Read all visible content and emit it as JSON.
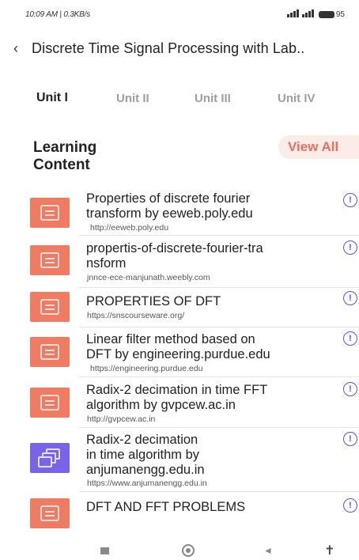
{
  "status_bar": {
    "left_text": "10:09 AM | 0.3KB/s",
    "right_icons": [
      "signal-icon",
      "wifi-icon",
      "battery-icon"
    ],
    "battery_level": "95"
  },
  "header": {
    "back_icon": "‹",
    "title": "Discrete Time Signal Processing with Lab.."
  },
  "tabs": [
    {
      "label": "Unit I",
      "active": true
    },
    {
      "label": "Unit II",
      "active": false
    },
    {
      "label": "Unit III",
      "active": false
    },
    {
      "label": "Unit IV",
      "active": false
    }
  ],
  "section": {
    "title_line1": "Learning",
    "title_line2": "Content",
    "view_all": "View All"
  },
  "items": [
    {
      "title_lines": [
        "Properties of discrete fourier",
        "transform by eeweb.poly.edu"
      ],
      "url": "http://eeweb.poly.edu",
      "icon": "document-icon",
      "color": "#ef7b63"
    },
    {
      "title_lines": [
        "propertis-of-discrete-fourier-tra",
        "nsform"
      ],
      "url": "jnnce-ece-manjunath.weebly.com",
      "icon": "document-icon",
      "color": "#ef7b63"
    },
    {
      "title_lines": [
        "PROPERTIES OF DFT"
      ],
      "url": "https://snscourseware.org/",
      "icon": "document-icon",
      "color": "#ef7b63"
    },
    {
      "title_lines": [
        "Linear filter method based on",
        "DFT by engineering.purdue.edu"
      ],
      "url": "https://engineering.purdue.edu",
      "icon": "document-icon",
      "color": "#ef7b63"
    },
    {
      "title_lines": [
        "Radix-2 decimation in time FFT",
        "algorithm by gvpcew.ac.in"
      ],
      "url": "http://gvpcew.ac.in",
      "icon": "document-icon",
      "color": "#ef7b63"
    },
    {
      "title_lines": [
        "Radix-2 decimation",
        "in time algorithm by",
        "anjumanengg.edu.in"
      ],
      "url": "https://www.anjumanengg.edu.in",
      "icon": "copy-icon",
      "color": "#7a63e8"
    },
    {
      "title_lines": [
        "DFT AND FFT PROBLEMS"
      ],
      "url": "",
      "icon": "document-icon",
      "color": "#ef7b63"
    }
  ],
  "info_glyph": "!",
  "nav_bar": {
    "back_glyph": "◄",
    "accessibility_glyph": "✝"
  }
}
